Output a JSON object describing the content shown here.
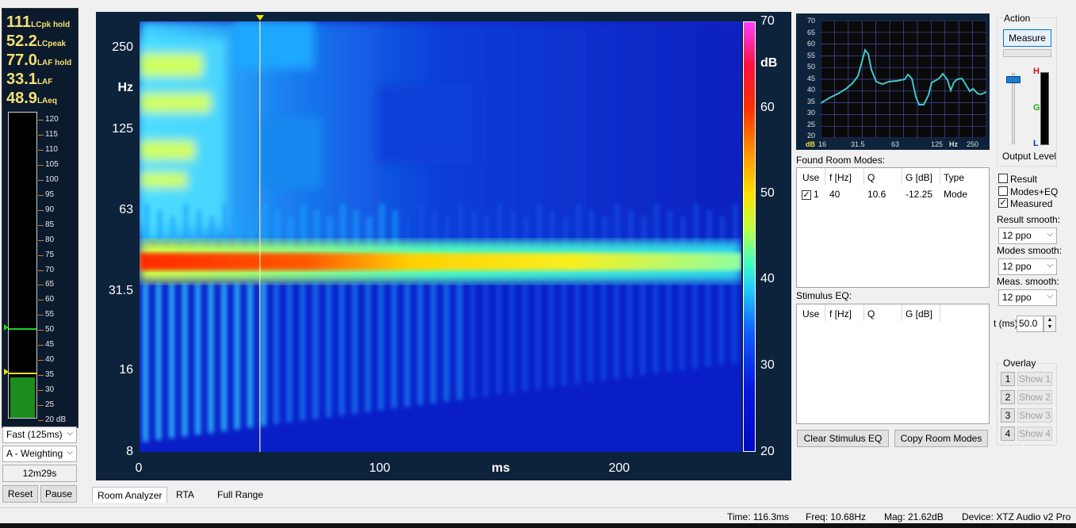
{
  "meters": {
    "readouts": [
      {
        "value": "111",
        "label": "LCpk hold"
      },
      {
        "value": "52.2",
        "label": "LCpeak"
      },
      {
        "value": "77.0",
        "label": "LAF hold"
      },
      {
        "value": "33.1",
        "label": "LAF"
      },
      {
        "value": "48.9",
        "label": "LAeq"
      }
    ],
    "db_scale": [
      "120",
      "115",
      "110",
      "105",
      "100",
      "95",
      "90",
      "85",
      "80",
      "75",
      "70",
      "65",
      "60",
      "55",
      "50",
      "45",
      "40",
      "35",
      "30",
      "25",
      "20 dB"
    ],
    "bar_level_db": 34,
    "green_marker_db": 51,
    "yellow_marker_db": 36,
    "speed_select": "Fast (125ms)",
    "weighting_select": "A - Weighting",
    "elapsed": "12m29s",
    "reset_label": "Reset",
    "pause_label": "Pause"
  },
  "spectrogram": {
    "y_ticks": [
      "250",
      "Hz",
      "125",
      "63",
      "31.5",
      "16",
      "8"
    ],
    "x_ticks": [
      "0",
      "100",
      "ms",
      "200"
    ],
    "colorbar_ticks": [
      "70",
      "dB",
      "60",
      "50",
      "40",
      "30",
      "20"
    ],
    "cursor_ms": 50
  },
  "small_chart": {
    "y_ticks": [
      "70",
      "65",
      "60",
      "55",
      "50",
      "45",
      "40",
      "35",
      "30",
      "25",
      "20"
    ],
    "x_ticks": [
      "dB",
      "16",
      "31.5",
      "63",
      "125",
      "Hz",
      "250"
    ],
    "line_color": "#3fc8c8"
  },
  "room_modes": {
    "title": "Found Room Modes:",
    "headers": [
      "Use",
      "f [Hz]",
      "Q",
      "G [dB]",
      "Type"
    ],
    "rows": [
      {
        "use": "1",
        "checked": "✓",
        "f": "40",
        "q": "10.6",
        "g": "-12.25",
        "type": "Mode"
      }
    ]
  },
  "stimulus_eq": {
    "title": "Stimulus EQ:",
    "headers": [
      "Use",
      "f [Hz]",
      "Q",
      "G [dB]"
    ]
  },
  "actions": {
    "group": "Action",
    "measure": "Measure",
    "output_level": "Output Level",
    "level_letters": [
      "H",
      "G",
      "L"
    ],
    "result": "Result",
    "modes_eq": "Modes+EQ",
    "measured": "Measured",
    "measured_check": "✓",
    "result_smooth_label": "Result smooth:",
    "result_smooth": "12 ppo",
    "modes_smooth_label": "Modes smooth:",
    "modes_smooth": "12 ppo",
    "meas_smooth_label": "Meas. smooth:",
    "meas_smooth": "12 ppo",
    "t_label": "t (ms)",
    "t_value": "50.0",
    "overlay": "Overlay",
    "overlays": [
      {
        "num": "1",
        "show": "Show 1"
      },
      {
        "num": "2",
        "show": "Show 2"
      },
      {
        "num": "3",
        "show": "Show 3"
      },
      {
        "num": "4",
        "show": "Show 4"
      }
    ],
    "clear_stimulus": "Clear Stimulus EQ",
    "copy_modes": "Copy Room Modes"
  },
  "tabs": [
    "Room Analyzer",
    "RTA",
    "Full Range"
  ],
  "status": {
    "time": "Time: 116.3ms",
    "freq": "Freq: 10.68Hz",
    "mag": "Mag: 21.62dB",
    "device": "Device: XTZ Audio v2 Pro"
  }
}
